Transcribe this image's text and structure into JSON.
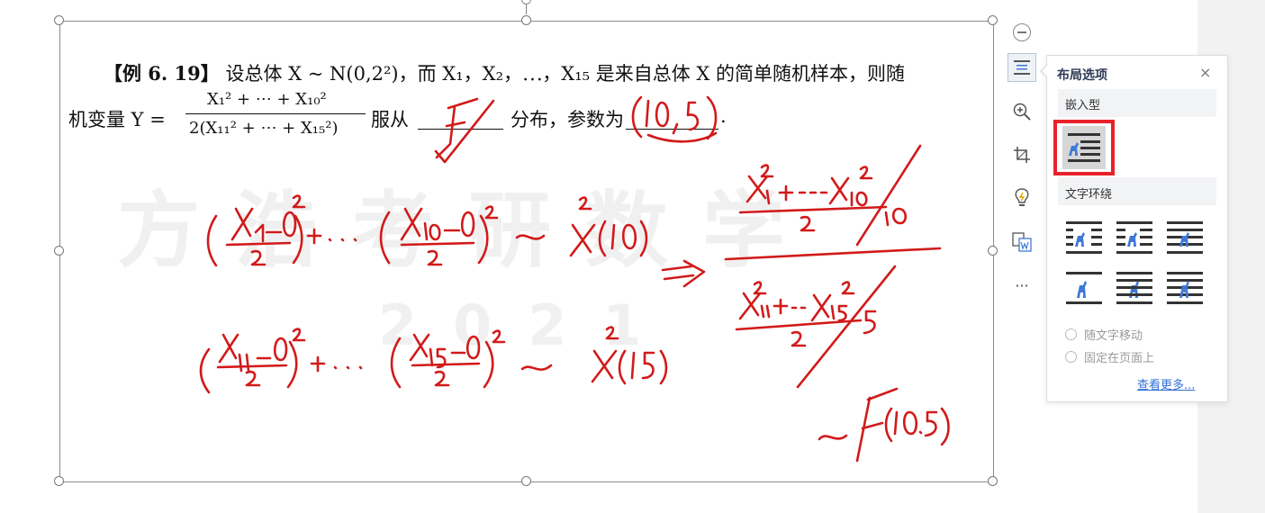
{
  "problem": {
    "title": "【例 6. 19】",
    "line1_text": "设总体 X ~ N(0,2²)，而 X₁，X₂，⋯，X₁₅ 是来自总体 X 的简单随机样本，则随",
    "line2_prefix": "机变量 Y =",
    "frac_numerator": "X₁² + ⋯ + X₁₀²",
    "frac_denominator": "2(X₁₁² + ⋯ + X₁₅²)",
    "line2_mid": "服从",
    "line2_mid2": "分布，参数为",
    "line2_end": "."
  },
  "watermark": {
    "text": "方浩考研数学",
    "year": "2021"
  },
  "toolbar": {
    "items": [
      "layout-options",
      "zoom",
      "crop",
      "effects",
      "convert",
      "more"
    ],
    "more_label": "···"
  },
  "layout_panel": {
    "title": "布局选项",
    "close_label": "×",
    "section_inline": "嵌入型",
    "section_wrap": "文字环绕",
    "radio_move_with_text": "随文字移动",
    "radio_fix_on_page": "固定在页面上",
    "see_more_link": "查看更多..."
  },
  "colors": {
    "ink": "#d21a1a",
    "icon_blue": "#3f78d8",
    "highlight": "#e8222a",
    "link": "#2f6fd6"
  }
}
